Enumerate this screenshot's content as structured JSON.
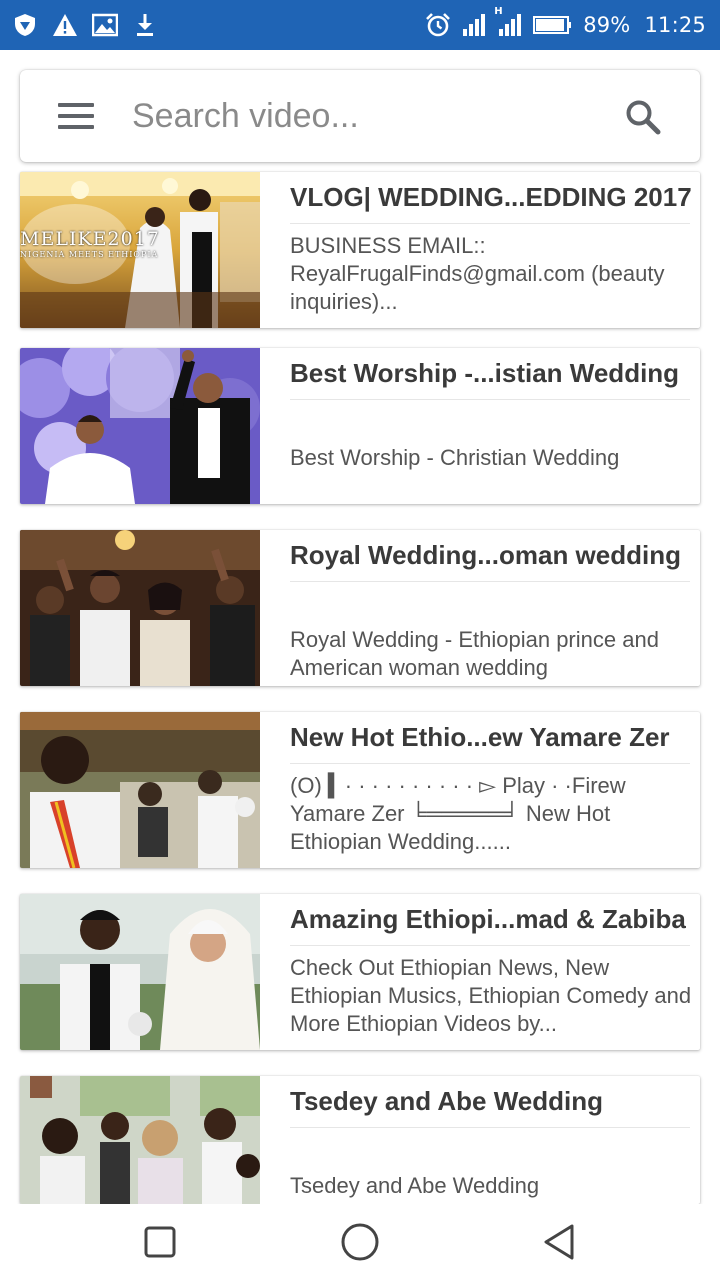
{
  "status_bar": {
    "left_icons": [
      "shield-icon",
      "warning-icon",
      "image-icon",
      "download-icon"
    ],
    "right_icons": [
      "alarm-icon",
      "signal-icon",
      "signal-h-icon",
      "battery-icon"
    ],
    "network_type": "H",
    "battery": "89%",
    "time": "11:25",
    "background": "#1f64b5"
  },
  "search": {
    "placeholder": "Search video...",
    "value": ""
  },
  "videos": [
    {
      "title": "VLOG| WEDDING...EDDING 2017",
      "description": "BUSINESS EMAIL:: ReyalFrugalFinds@gmail.com (beauty inquiries)...",
      "thumbnail_text": "MELIKE2017",
      "thumbnail_subtext": "NIGENIA MEETS ETHIOPIA",
      "thumbnail_scene": "wedding-couple-stage"
    },
    {
      "title": "Best Worship -...istian Wedding",
      "description": "Best Worship - Christian Wedding",
      "thumbnail_scene": "bride-groom-flowers"
    },
    {
      "title": "Royal Wedding...oman wedding",
      "description": "Royal Wedding - Ethiopian prince and American woman wedding",
      "thumbnail_scene": "dancing-crowd"
    },
    {
      "title": "New Hot Ethio...ew Yamare Zer",
      "description": "(O) ▍· · · · · · · · · · ▻ Play · ·Firew Yamare Zer ╘═════╛ New Hot Ethiopian Wedding......",
      "thumbnail_scene": "outdoor-celebration"
    },
    {
      "title": "Amazing Ethiopi...mad & Zabiba",
      "description": "Check Out Ethiopian News, New Ethiopian Musics, Ethiopian Comedy and More Ethiopian Videos by...",
      "thumbnail_scene": "couple-portrait"
    },
    {
      "title": "Tsedey and Abe Wedding",
      "description": "Tsedey and Abe Wedding",
      "thumbnail_scene": "guests-crowd"
    }
  ],
  "nav_bar": {
    "buttons": [
      "recents-square-icon",
      "home-circle-icon",
      "back-triangle-icon"
    ]
  }
}
